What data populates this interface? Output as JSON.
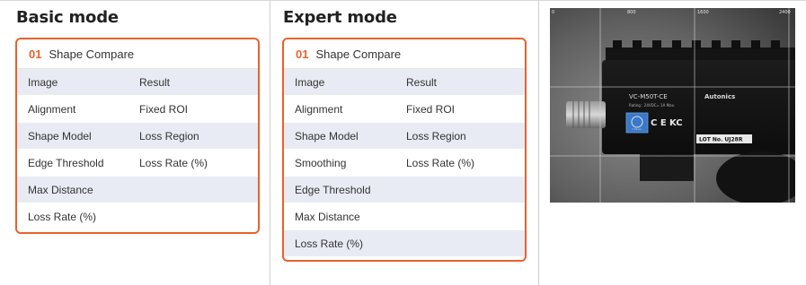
{
  "basic": {
    "title": "Basic mode",
    "tool_number": "01",
    "tool_name": "Shape Compare",
    "rows": [
      {
        "left": "Image",
        "right": "Result"
      },
      {
        "left": "Alignment",
        "right": "Fixed ROI"
      },
      {
        "left": "Shape Model",
        "right": "Loss Region"
      },
      {
        "left": "Edge Threshold",
        "right": "Loss Rate (%)"
      },
      {
        "left": "Max Distance",
        "right": ""
      },
      {
        "left": "Loss Rate (%)",
        "right": ""
      }
    ]
  },
  "expert": {
    "title": "Expert mode",
    "tool_number": "01",
    "tool_name": "Shape Compare",
    "rows": [
      {
        "left": "Image",
        "right": "Result"
      },
      {
        "left": "Alignment",
        "right": "Fixed ROI"
      },
      {
        "left": "Shape Model",
        "right": "Loss Region"
      },
      {
        "left": "Smoothing",
        "right": "Loss Rate (%)"
      },
      {
        "left": "Edge Threshold",
        "right": ""
      },
      {
        "left": "Max Distance",
        "right": ""
      },
      {
        "left": "Loss Rate (%)",
        "right": ""
      }
    ]
  },
  "camera_view": {
    "ruler_ticks": [
      "0",
      "800",
      "1600",
      "2400"
    ],
    "device_label": "VC-M50T-CE",
    "device_rating": "Rating : 24VDC= 1A Max.",
    "brand": "Autonics",
    "lot_label": "LOT No. UJ28R",
    "cert_marks": "c UL us",
    "ce_mark": "C E",
    "kc_mark": "KC"
  },
  "colors": {
    "accent": "#e8622c",
    "row_shade": "#e9ebf4",
    "roi_box": "#3a78c8"
  }
}
